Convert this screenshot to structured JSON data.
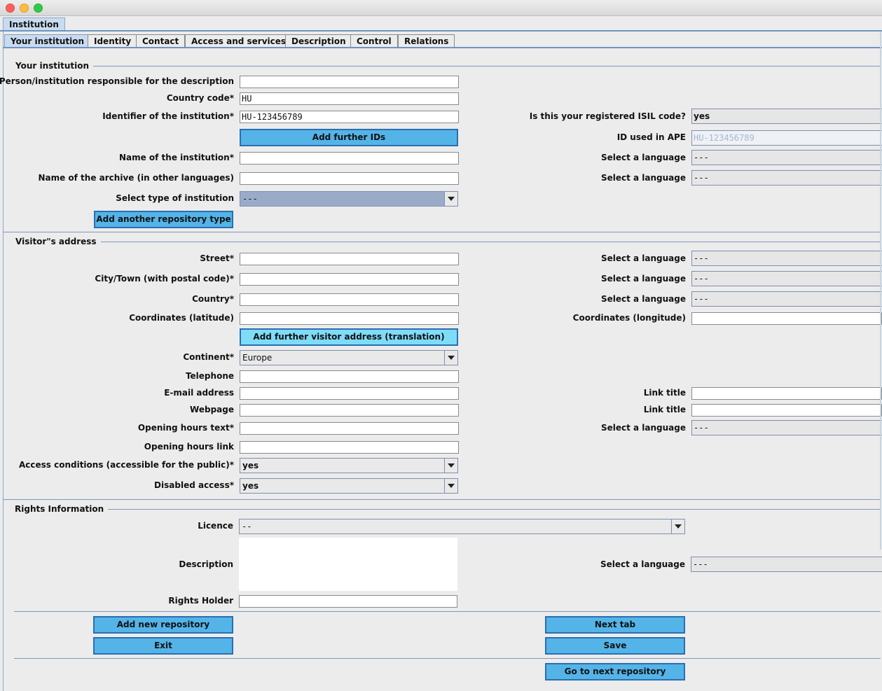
{
  "window": {
    "outer_tab": "Institution"
  },
  "tabs": [
    "Your institution",
    "Identity",
    "Contact",
    "Access and services",
    "Description",
    "Control",
    "Relations"
  ],
  "sections": {
    "institution": "Your institution",
    "visitor": "Visitor\"s address",
    "rights": "Rights Information"
  },
  "institution": {
    "responsible_label": "Person/institution responsible for the description",
    "responsible_value": "",
    "country_code_label": "Country code*",
    "country_code_value": "HU",
    "identifier_label": "Identifier of the institution*",
    "identifier_value": "HU-123456789",
    "isil_label": "Is this your registered ISIL code?",
    "isil_value": "yes",
    "add_ids_button": "Add further IDs",
    "id_ape_label": "ID used in APE",
    "id_ape_value": "HU-123456789",
    "name_label": "Name of the institution*",
    "name_value": "",
    "name_lang_label": "Select a language",
    "name_lang_value": "---",
    "archive_name_label": "Name of the archive (in other languages)",
    "archive_name_value": "",
    "archive_lang_label": "Select a language",
    "archive_lang_value": "---",
    "type_label": "Select type of institution",
    "type_value": "---",
    "add_repo_type_button": "Add another repository type"
  },
  "visitor": {
    "street_label": "Street*",
    "street_lang_label": "Select a language",
    "street_lang_value": "---",
    "city_label": "City/Town (with postal code)*",
    "city_lang_label": "Select a language",
    "city_lang_value": "---",
    "country_label": "Country*",
    "country_lang_label": "Select a language",
    "country_lang_value": "---",
    "lat_label": "Coordinates (latitude)",
    "lon_label": "Coordinates (longitude)",
    "add_address_button": "Add further visitor address (translation)",
    "continent_label": "Continent*",
    "continent_value": "Europe",
    "telephone_label": "Telephone",
    "email_label": "E-mail address",
    "email_link_label": "Link title",
    "webpage_label": "Webpage",
    "webpage_link_label": "Link title",
    "hours_text_label": "Opening hours text*",
    "hours_lang_label": "Select a language",
    "hours_lang_value": "---",
    "hours_link_label": "Opening hours link",
    "access_label": "Access conditions (accessible for the public)*",
    "access_value": "yes",
    "disabled_label": "Disabled access*",
    "disabled_value": "yes"
  },
  "rights": {
    "licence_label": "Licence",
    "licence_value": "--",
    "description_label": "Description",
    "desc_lang_label": "Select a language",
    "desc_lang_value": "---",
    "holder_label": "Rights Holder"
  },
  "buttons": {
    "add_repository": "Add new repository",
    "next_tab": "Next tab",
    "exit": "Exit",
    "save": "Save",
    "next_repository": "Go to next repository"
  }
}
